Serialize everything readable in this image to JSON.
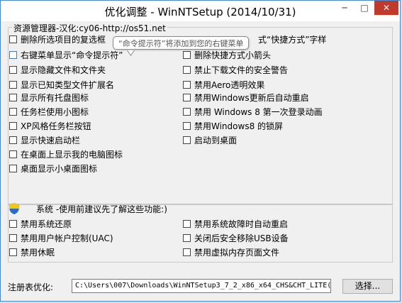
{
  "window": {
    "title": "优化调整 - WinNTSetup (2014/10/31)",
    "min_glyph": "─",
    "max_glyph": "□",
    "close_glyph": "✕"
  },
  "explorer_group": {
    "legend": "资源管理器-汉化:cy06-http://os51.net",
    "tooltip": "“命令提示符”将添加到您的右键菜单",
    "left": [
      "删除所选项目的复选框",
      "右键菜单显示“命令提示符”",
      "显示隐藏文件和文件夹",
      "显示已知类型文件扩展名",
      "显示所有托盘图标",
      "任务栏使用小图标",
      "XP风格任务栏按钮",
      "显示快速启动栏",
      "在桌面上显示我的电脑图标",
      "桌面显示小桌面图标"
    ],
    "right": [
      "式“快捷方式”字样",
      "删除快捷方式小箭头",
      "禁止下载文件的安全警告",
      "禁用Aero透明效果",
      "禁用Windows更新后自动重启",
      "禁用 Windows 8 第一次登录动画",
      "禁用Windows8 的锁屏",
      "启动到桌面"
    ]
  },
  "system_group": {
    "heading": "系统 -使用前建议先了解这些功能:)",
    "shield_icon": "uac-shield-icon",
    "left": [
      "禁用系统还原",
      "禁用用户帐户控制(UAC)",
      "禁用休眠"
    ],
    "right": [
      "禁用系统故障时自动重启",
      "关闭后安全移除USB设备",
      "禁用虚拟内存页面文件"
    ]
  },
  "registry": {
    "label": "注册表优化:",
    "path": "C:\\Users\\007\\Downloads\\WinNTSetup3_7_2_x86_x64_CHS&CHT_LITE(",
    "browse_label": "选择..."
  },
  "colors": {
    "window_border": "#4f86c6",
    "close_button": "#c0392b",
    "face": "#f0f0f0"
  }
}
